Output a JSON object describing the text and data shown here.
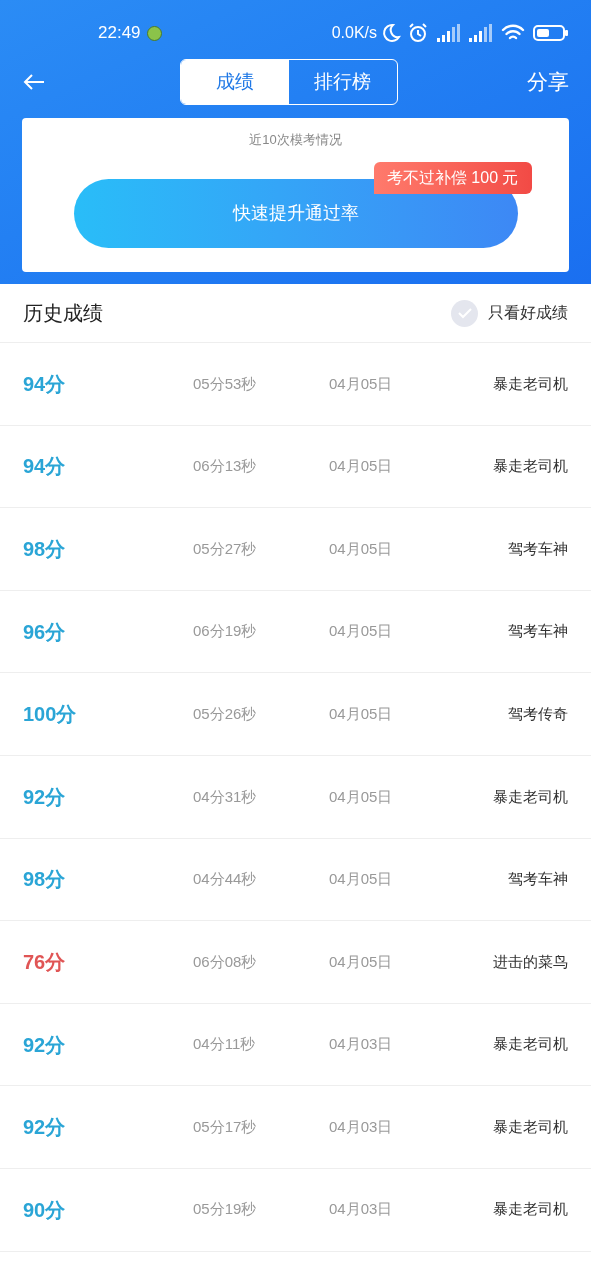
{
  "status_bar": {
    "time": "22:49",
    "net_speed": "0.0K/s"
  },
  "nav": {
    "tabs": [
      {
        "label": "成绩",
        "selected": true
      },
      {
        "label": "排行榜",
        "selected": false
      }
    ],
    "share": "分享"
  },
  "card": {
    "subtitle": "近10次模考情况",
    "button": "快速提升通过率",
    "badge": "考不过补偿 100 元"
  },
  "history": {
    "title": "历史成绩",
    "filter": {
      "label": "只看好成绩",
      "checked": false
    }
  },
  "rows": [
    {
      "score": "94分",
      "failed": false,
      "duration": "05分53秒",
      "date": "04月05日",
      "rank": "暴走老司机"
    },
    {
      "score": "94分",
      "failed": false,
      "duration": "06分13秒",
      "date": "04月05日",
      "rank": "暴走老司机"
    },
    {
      "score": "98分",
      "failed": false,
      "duration": "05分27秒",
      "date": "04月05日",
      "rank": "驾考车神"
    },
    {
      "score": "96分",
      "failed": false,
      "duration": "06分19秒",
      "date": "04月05日",
      "rank": "驾考车神"
    },
    {
      "score": "100分",
      "failed": false,
      "duration": "05分26秒",
      "date": "04月05日",
      "rank": "驾考传奇"
    },
    {
      "score": "92分",
      "failed": false,
      "duration": "04分31秒",
      "date": "04月05日",
      "rank": "暴走老司机"
    },
    {
      "score": "98分",
      "failed": false,
      "duration": "04分44秒",
      "date": "04月05日",
      "rank": "驾考车神"
    },
    {
      "score": "76分",
      "failed": true,
      "duration": "06分08秒",
      "date": "04月05日",
      "rank": "进击的菜鸟"
    },
    {
      "score": "92分",
      "failed": false,
      "duration": "04分11秒",
      "date": "04月03日",
      "rank": "暴走老司机"
    },
    {
      "score": "92分",
      "failed": false,
      "duration": "05分17秒",
      "date": "04月03日",
      "rank": "暴走老司机"
    },
    {
      "score": "90分",
      "failed": false,
      "duration": "05分19秒",
      "date": "04月03日",
      "rank": "暴走老司机"
    }
  ]
}
